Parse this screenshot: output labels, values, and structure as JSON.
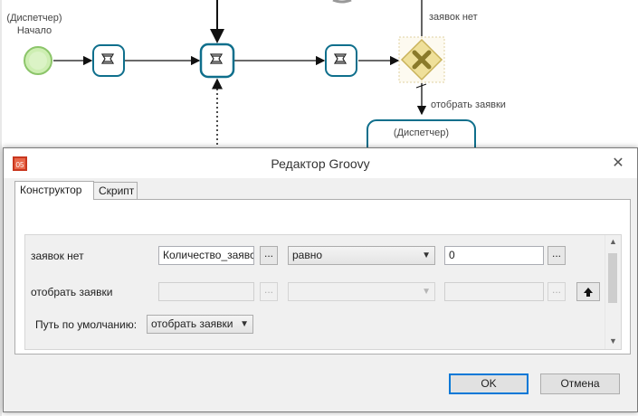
{
  "canvas": {
    "start_label_line1": "(Диспетчер)",
    "start_label_line2": "Начало",
    "flow_label_no_requests": "заявок нет",
    "flow_label_select": "отобрать заявки",
    "lane_task_label": "(Диспетчер)"
  },
  "dialog": {
    "title": "Редактор Groovy",
    "close_glyph": "✕",
    "tabs": [
      {
        "label": "Конструктор",
        "active": true
      },
      {
        "label": "Скрипт",
        "active": false
      }
    ],
    "rows": [
      {
        "label": "заявок нет",
        "variable": "Количество_заявс",
        "ellipsis": "...",
        "operator": "равно",
        "value": "0",
        "value_ellipsis": "..."
      },
      {
        "label": "отобрать заявки",
        "variable": "",
        "ellipsis": "...",
        "operator": "",
        "value": "",
        "value_ellipsis": "...",
        "move_up_glyph": "🡅"
      }
    ],
    "default_path": {
      "label": "Путь по умолчанию:",
      "selected": "отобрать заявки"
    },
    "ok_label": "OK",
    "cancel_label": "Отмена"
  },
  "colors": {
    "task_border": "#0f6f8c",
    "gateway_fill": "#f3e5a8",
    "start_fill": "#c7f0a8",
    "accent": "#0078d7"
  }
}
